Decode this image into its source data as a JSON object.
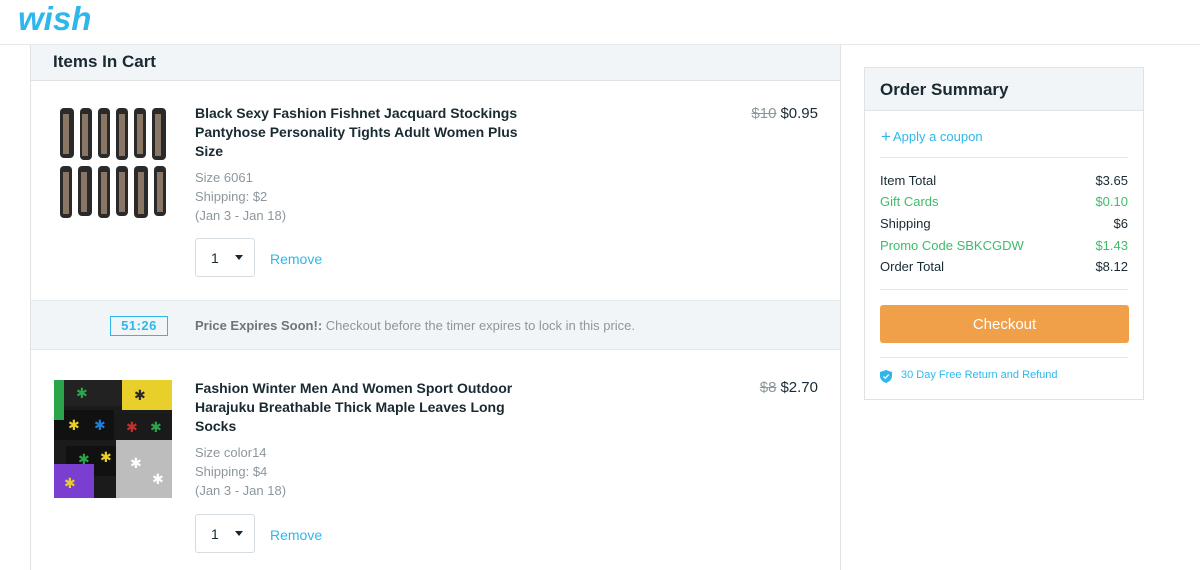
{
  "brand": {
    "logo_text": "wish",
    "color": "#2fb7ec"
  },
  "cart": {
    "heading": "Items In Cart",
    "items": [
      {
        "title": "Black Sexy Fashion Fishnet Jacquard Stockings Pantyhose Personality Tights Adult Women Plus Size",
        "old_price": "$10",
        "price": "$0.95",
        "size": "Size 6061",
        "shipping": "Shipping: $2",
        "delivery": "(Jan 3 - Jan 18)",
        "quantity": "1",
        "remove_label": "Remove",
        "image_icon": "stockings-product-image"
      },
      {
        "title": "Fashion Winter Men And Women Sport Outdoor Harajuku Breathable Thick Maple Leaves Long Socks",
        "old_price": "$8",
        "price": "$2.70",
        "size": "Size color14",
        "shipping": "Shipping: $4",
        "delivery": "(Jan 3 - Jan 18)",
        "quantity": "1",
        "remove_label": "Remove",
        "image_icon": "socks-product-image"
      }
    ],
    "timer": {
      "value": "51:26",
      "label": "Price Expires Soon!:",
      "message": " Checkout before the timer expires to lock in this price."
    }
  },
  "summary": {
    "heading": "Order Summary",
    "coupon_label": "Apply a coupon",
    "rows": [
      {
        "label": "Item Total",
        "amount": "$3.65"
      },
      {
        "label": "Gift Cards",
        "amount": "$0.10"
      },
      {
        "label": "Shipping",
        "amount": "$6"
      },
      {
        "label": "Promo Code SBKCGDW",
        "amount": "$1.43"
      },
      {
        "label": "Order Total",
        "amount": "$8.12"
      }
    ],
    "checkout_label": "Checkout",
    "guarantee": "30 Day Free Return and Refund"
  },
  "colors": {
    "accent": "#2fb7ec",
    "discount_green": "#3fbb6b",
    "checkout_orange": "#f0a049"
  }
}
